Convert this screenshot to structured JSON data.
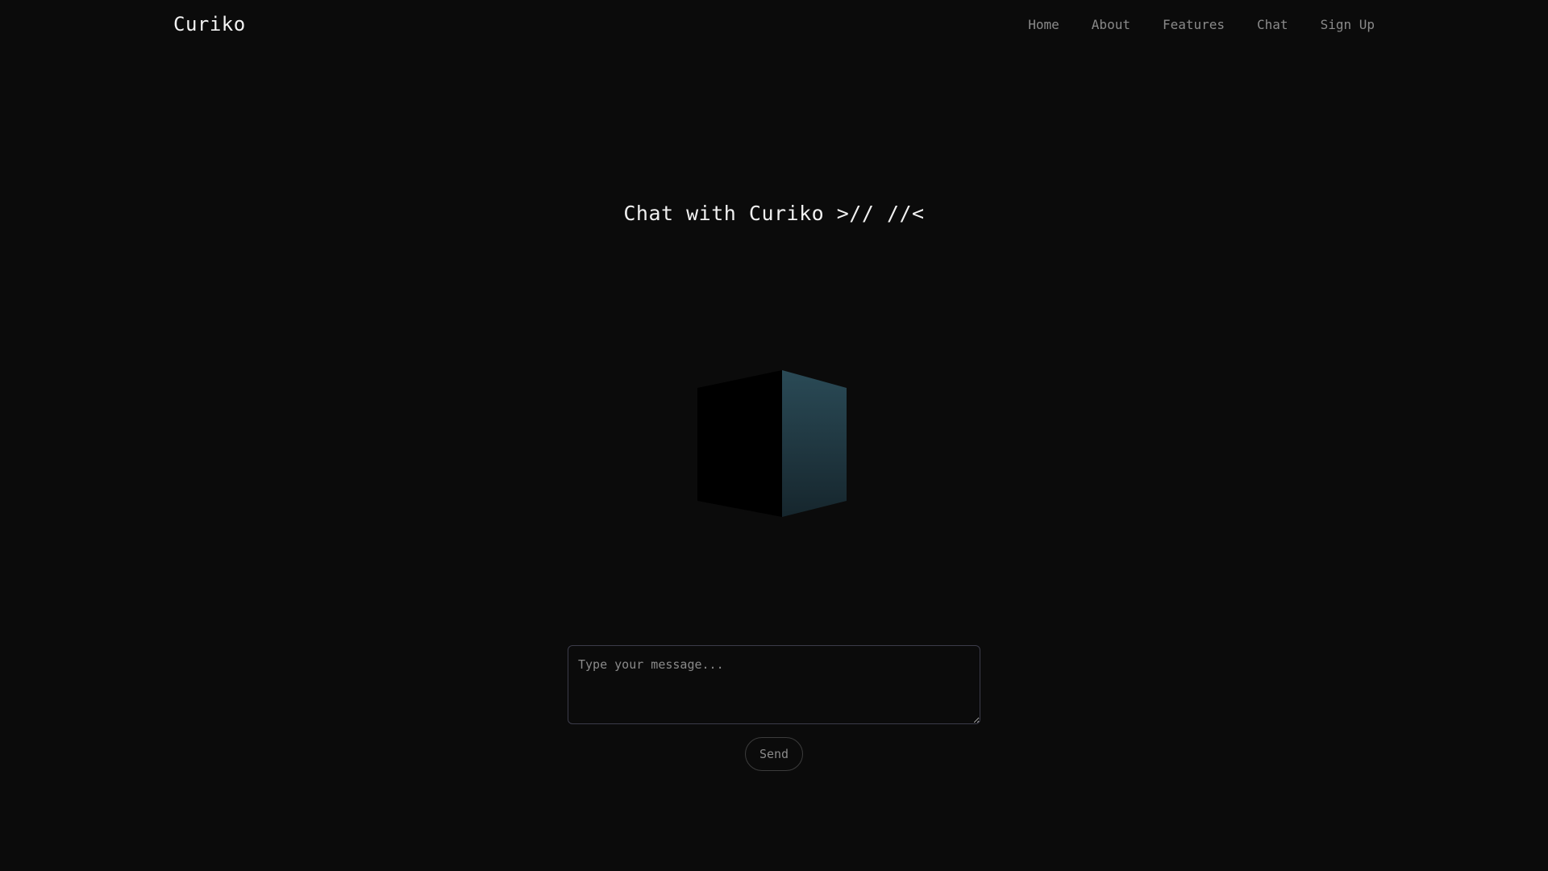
{
  "header": {
    "logo": "Curiko",
    "nav": [
      {
        "label": "Home"
      },
      {
        "label": "About"
      },
      {
        "label": "Features"
      },
      {
        "label": "Chat"
      },
      {
        "label": "Sign Up"
      }
    ]
  },
  "main": {
    "title": "Chat with Curiko >// //<",
    "message": {
      "value": "",
      "placeholder": "Type your message..."
    },
    "send_label": "Send"
  },
  "colors": {
    "background": "#0b0b0b",
    "cube_left_face": "#000000",
    "cube_right_face": "#23404b",
    "text": "#f0f0f0",
    "muted_text": "#8a8a8a"
  }
}
